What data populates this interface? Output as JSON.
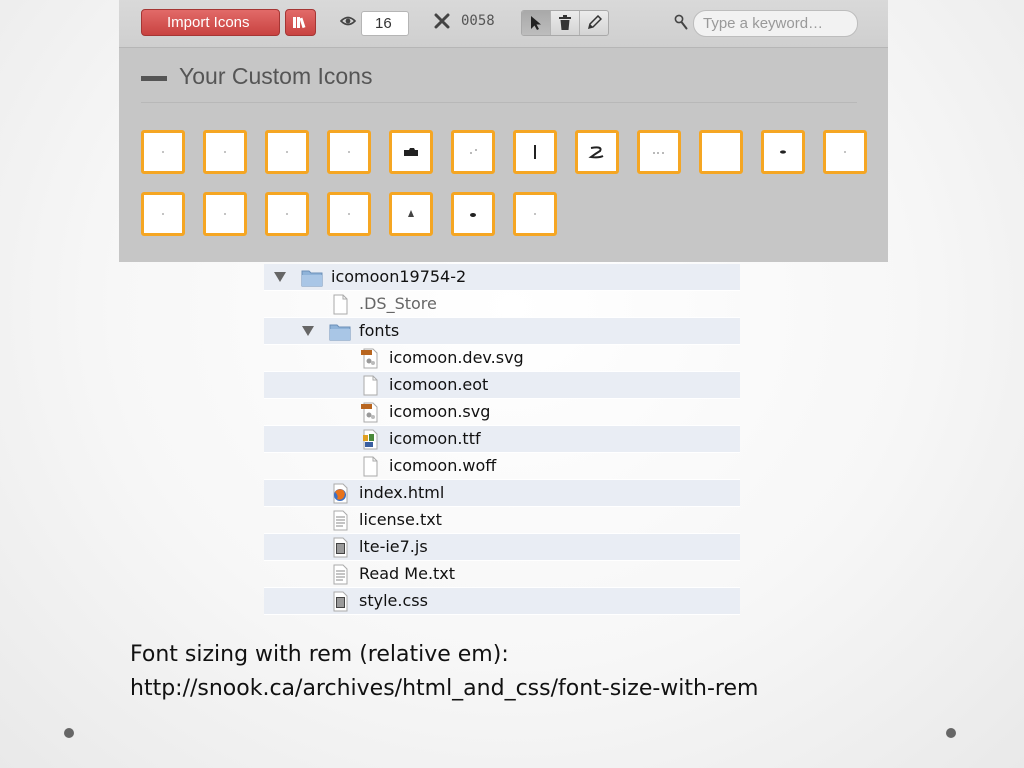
{
  "toolbar": {
    "import_label": "Import Icons",
    "size_value": "16",
    "count_label": "0058",
    "search_placeholder": "Type a keyword…"
  },
  "section": {
    "title": "Your Custom Icons"
  },
  "icon_tiles": {
    "row1_count": 12,
    "row2_count": 7
  },
  "files": [
    {
      "name": "icomoon19754-2",
      "type": "folder",
      "expanded": true,
      "indent": 0
    },
    {
      "name": ".DS_Store",
      "type": "file-blank",
      "indent": 1,
      "dim": true
    },
    {
      "name": "fonts",
      "type": "folder",
      "expanded": true,
      "indent": 1
    },
    {
      "name": "icomoon.dev.svg",
      "type": "file-svg",
      "indent": 2
    },
    {
      "name": "icomoon.eot",
      "type": "file-blank",
      "indent": 2
    },
    {
      "name": "icomoon.svg",
      "type": "file-svg",
      "indent": 2
    },
    {
      "name": "icomoon.ttf",
      "type": "file-font",
      "indent": 2
    },
    {
      "name": "icomoon.woff",
      "type": "file-blank",
      "indent": 2
    },
    {
      "name": "index.html",
      "type": "file-firefox",
      "indent": 1
    },
    {
      "name": "license.txt",
      "type": "file-text",
      "indent": 1
    },
    {
      "name": "lte-ie7.js",
      "type": "file-script",
      "indent": 1
    },
    {
      "name": "Read Me.txt",
      "type": "file-text",
      "indent": 1
    },
    {
      "name": "style.css",
      "type": "file-script",
      "indent": 1
    }
  ],
  "caption": {
    "line1": "Font sizing with rem (relative em):",
    "line2": "http://snook.ca/archives/html_and_css/font-size-with-rem"
  },
  "colors": {
    "accent_red": "#d0514f",
    "tile_border": "#f5a623",
    "row_stripe": "#e9edf4"
  }
}
